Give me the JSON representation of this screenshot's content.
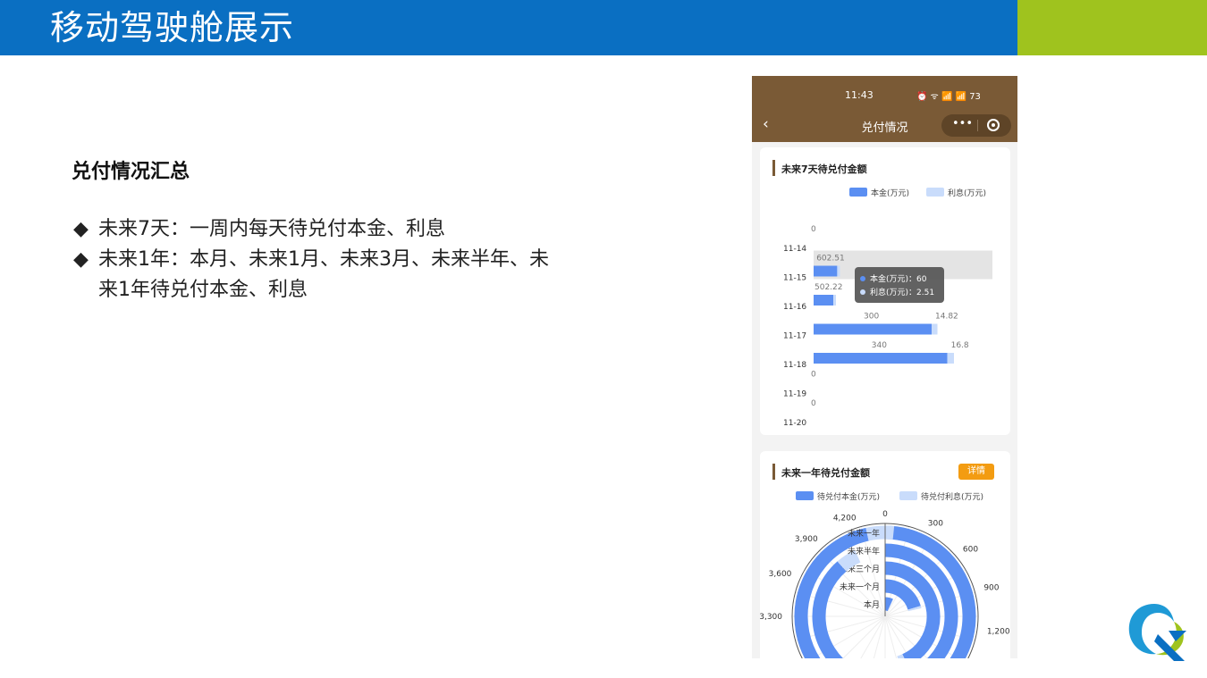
{
  "slide": {
    "title": "移动驾驶舱展示",
    "heading": "兑付情况汇总",
    "bullets": [
      {
        "line1": "未来7天：一周内每天待兑付本金、利息",
        "line2": ""
      },
      {
        "line1": "未来1年：本月、未来1月、未来3月、未来半年、未",
        "line2": "来1年待兑付本金、利息"
      }
    ],
    "bullet_glyph": "◆"
  },
  "phone": {
    "status_time": "11:43",
    "status_icons": "⏰ ᯤ 📶 📶 73",
    "back_glyph": "‹",
    "page_title": "兑付情况",
    "menu_glyph": "•••",
    "colors": {
      "header": "#7a5a36",
      "principal": "#5b8ff2",
      "interest": "#c9dcfb"
    }
  },
  "chart_data": [
    {
      "type": "bar",
      "orientation": "horizontal",
      "stacked": true,
      "title": "未来7天待兑付金额",
      "categories": [
        "11-14",
        "11-15",
        "11-16",
        "11-17",
        "11-18",
        "11-19",
        "11-20"
      ],
      "series": [
        {
          "name": "本金(万元)",
          "values": [
            0,
            60,
            50,
            300,
            340,
            0,
            0
          ]
        },
        {
          "name": "利息(万元)",
          "values": [
            0,
            2.51,
            2.22,
            14.82,
            16.8,
            0,
            0
          ]
        }
      ],
      "data_labels": [
        "0",
        "602.51",
        "502.22",
        "300",
        "340",
        "0",
        "0"
      ],
      "interest_labels": [
        "",
        "",
        "",
        "14.82",
        "16.8",
        "",
        ""
      ],
      "highlight_category": "11-15",
      "tooltip": {
        "principal": "本金(万元)：60",
        "interest": "利息(万元)：2.51"
      },
      "legend": "top-right"
    },
    {
      "type": "polar-bar",
      "title": "未来一年待兑付金额",
      "button": "详情",
      "categories": [
        "本月",
        "未来一个月",
        "未来三个月",
        "未来半年",
        "未来一年"
      ],
      "series": [
        {
          "name": "待兑付本金(万元)",
          "values": [
            300,
            900,
            1900,
            3900,
            4250
          ]
        },
        {
          "name": "待兑付利息(万元)",
          "values": [
            15,
            45,
            95,
            200,
            220
          ]
        }
      ],
      "angle_ticks": [
        "0",
        "300",
        "600",
        "900",
        "1,200",
        "3,300",
        "3,600",
        "3,900",
        "4,200"
      ],
      "angle_max": 4400,
      "legend": "top-center"
    }
  ]
}
